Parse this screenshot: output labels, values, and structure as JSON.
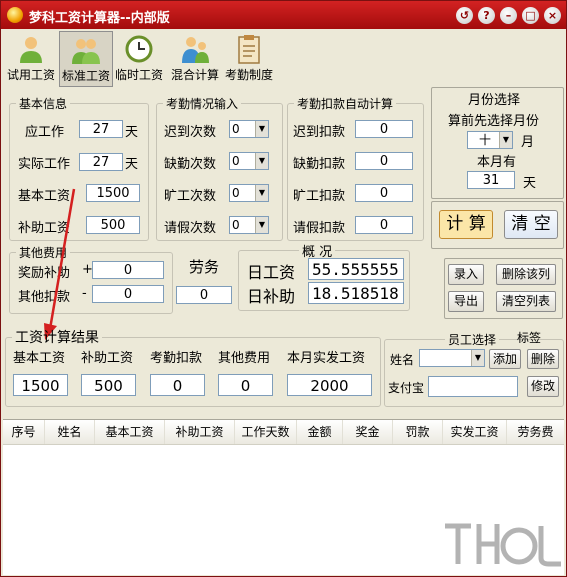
{
  "window": {
    "title": "梦科工资计算器--内部版"
  },
  "titlebar_buttons": [
    "restore-icon",
    "help-icon",
    "minimize-icon",
    "maximize-icon",
    "close-icon"
  ],
  "toolbar": [
    {
      "label": "试用工资",
      "icon": "person-icon",
      "active": false
    },
    {
      "label": "标准工资",
      "icon": "group-icon",
      "active": true
    },
    {
      "label": "临时工资",
      "icon": "clock-icon",
      "active": false
    },
    {
      "label": "混合计算",
      "icon": "people-icon",
      "active": false
    },
    {
      "label": "考勤制度",
      "icon": "clipboard-icon",
      "active": false
    }
  ],
  "basic_info": {
    "legend": "基本信息",
    "rows": [
      {
        "label": "应工作",
        "value": "27",
        "unit": "天"
      },
      {
        "label": "实际工作",
        "value": "27",
        "unit": "天"
      },
      {
        "label": "基本工资",
        "value": "1500"
      },
      {
        "label": "补助工资",
        "value": "500"
      }
    ]
  },
  "attendance_input": {
    "legend": "考勤情况输入",
    "rows": [
      {
        "label": "迟到次数",
        "value": "0"
      },
      {
        "label": "缺勤次数",
        "value": "0"
      },
      {
        "label": "旷工次数",
        "value": "0"
      },
      {
        "label": "请假次数",
        "value": "0"
      }
    ]
  },
  "deduction_auto": {
    "legend": "考勤扣款自动计算",
    "rows": [
      {
        "label": "迟到扣款",
        "value": "0"
      },
      {
        "label": "缺勤扣款",
        "value": "0"
      },
      {
        "label": "旷工扣款",
        "value": "0"
      },
      {
        "label": "请假扣款",
        "value": "0"
      }
    ]
  },
  "month_select": {
    "legend": "月份选择",
    "hint": "算前先选择月份",
    "month_value": "十",
    "month_unit": "月",
    "days_label": "本月有",
    "days_value": "31",
    "days_unit": "天"
  },
  "actions": {
    "calculate": "计 算",
    "clear": "清 空"
  },
  "other_fees": {
    "legend": "其他费用",
    "bonus_label": "奖励补助",
    "bonus_value": "0",
    "deduct_label": "其他扣款",
    "deduct_value": "0"
  },
  "labor": {
    "label": "劳务",
    "value": "0"
  },
  "overview": {
    "legend": "概 况",
    "daily_wage_label": "日工资",
    "daily_wage_value": "55.555555",
    "daily_subsidy_label": "日补助",
    "daily_subsidy_value": "18.518518"
  },
  "list_buttons": {
    "add": "录入",
    "delete_row": "删除该列",
    "export": "导出",
    "clear_list": "清空列表"
  },
  "result": {
    "legend": "工资计算结果",
    "columns": [
      {
        "label": "基本工资",
        "value": "1500"
      },
      {
        "label": "补助工资",
        "value": "500"
      },
      {
        "label": "考勤扣款",
        "value": "0"
      },
      {
        "label": "其他费用",
        "value": "0"
      },
      {
        "label": "本月实发工资",
        "value": "2000"
      }
    ]
  },
  "employee": {
    "legend": "员工选择",
    "tag_label": "标签",
    "name_label": "姓名",
    "name_value": "",
    "add_btn": "添加",
    "delete_btn": "删除",
    "alipay_label": "支付宝",
    "alipay_value": "",
    "edit_btn": "修改"
  },
  "table": {
    "headers": [
      "序号",
      "姓名",
      "基本工资",
      "补助工资",
      "工作天数",
      "金额",
      "奖金",
      "罚款",
      "实发工资",
      "劳务费"
    ],
    "rows": []
  },
  "colors": {
    "title_red": "#c41a1a",
    "arrow_red": "#d42020",
    "window_bg": "#ece9d8",
    "calc_btn_bg": "#fbe6a8"
  }
}
